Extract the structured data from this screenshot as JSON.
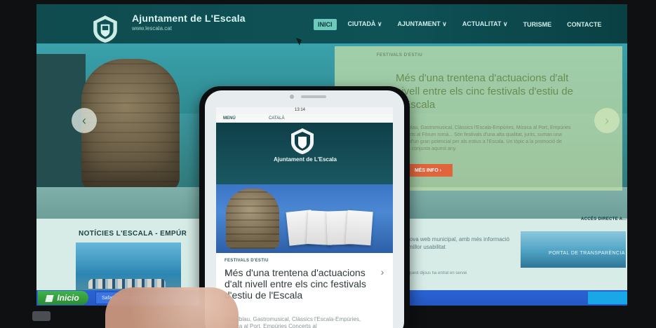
{
  "website": {
    "header": {
      "title": "Ajuntament de L'Escala",
      "url": "www.lescala.cat",
      "nav": [
        {
          "label": "INICI",
          "active": true
        },
        {
          "label": "CIUTADÀ ∨",
          "active": false
        },
        {
          "label": "AJUNTAMENT ∨",
          "active": false
        },
        {
          "label": "ACTUALITAT ∨",
          "active": false
        },
        {
          "label": "TURISME",
          "active": false
        },
        {
          "label": "CONTACTE",
          "active": false
        }
      ]
    },
    "hero": {
      "title": "Més d'una trentena d'actuacions d'alt nivell entre els cinc festivals d'estiu de L'Escala",
      "body": "Portalblau, Gastromusical, Clàssics l'Escala-Empúries, Música al Port, Empúries Concerts al Fòrum romà... Són festivals d'una alta qualitat, junts, suman una oferta d'un gran potencial per als estius a l'Escala. Un tòpic a la promoció de l'oferta conjunta aquest any.",
      "button": "MÉS INFO ›"
    },
    "content": {
      "news_title": "NOTÍCIES L'ESCALA - EMPÚR",
      "right_news_title": "Nova web municipal, amb més informació i millor usabilitat",
      "right_news_body": "Aquest dijous ha entrat en servei",
      "access_title": "ACCÉS DIRECTE A...",
      "transparency_label": "PORTAL DE TRANSPARÈNCIA"
    },
    "taskbar": {
      "start": "Inicio",
      "task": "Safata d'entrada -"
    }
  },
  "phone": {
    "status": {
      "time": "13:14"
    },
    "nav": {
      "menu": "MENÚ",
      "language": "CATALÀ"
    },
    "site_title": "Ajuntament de L'Escala",
    "kicker": "FESTIVALS D'ESTIU",
    "title": "Més d'una trentena d'actuacions d'alt nivell entre els cinc festivals d'estiu de l'Escala",
    "body": "Portalblau, Gastromusical, Clàssics l'Escala-Empúries, Música al Port, Empúries Concerts al"
  },
  "colors": {
    "site_header": "#0e5256",
    "nav_active": "#6ec9bd",
    "cta": "#e0643c",
    "taskbar": "#2658c3",
    "start_button": "#2c8a35"
  },
  "icons": {
    "hero_left": "chevron-left-icon",
    "hero_right": "chevron-right-icon",
    "phone_left": "chevron-left-icon",
    "phone_right": "chevron-right-icon",
    "cursor": "mouse-cursor-icon",
    "logo": "shield-logo-icon"
  }
}
